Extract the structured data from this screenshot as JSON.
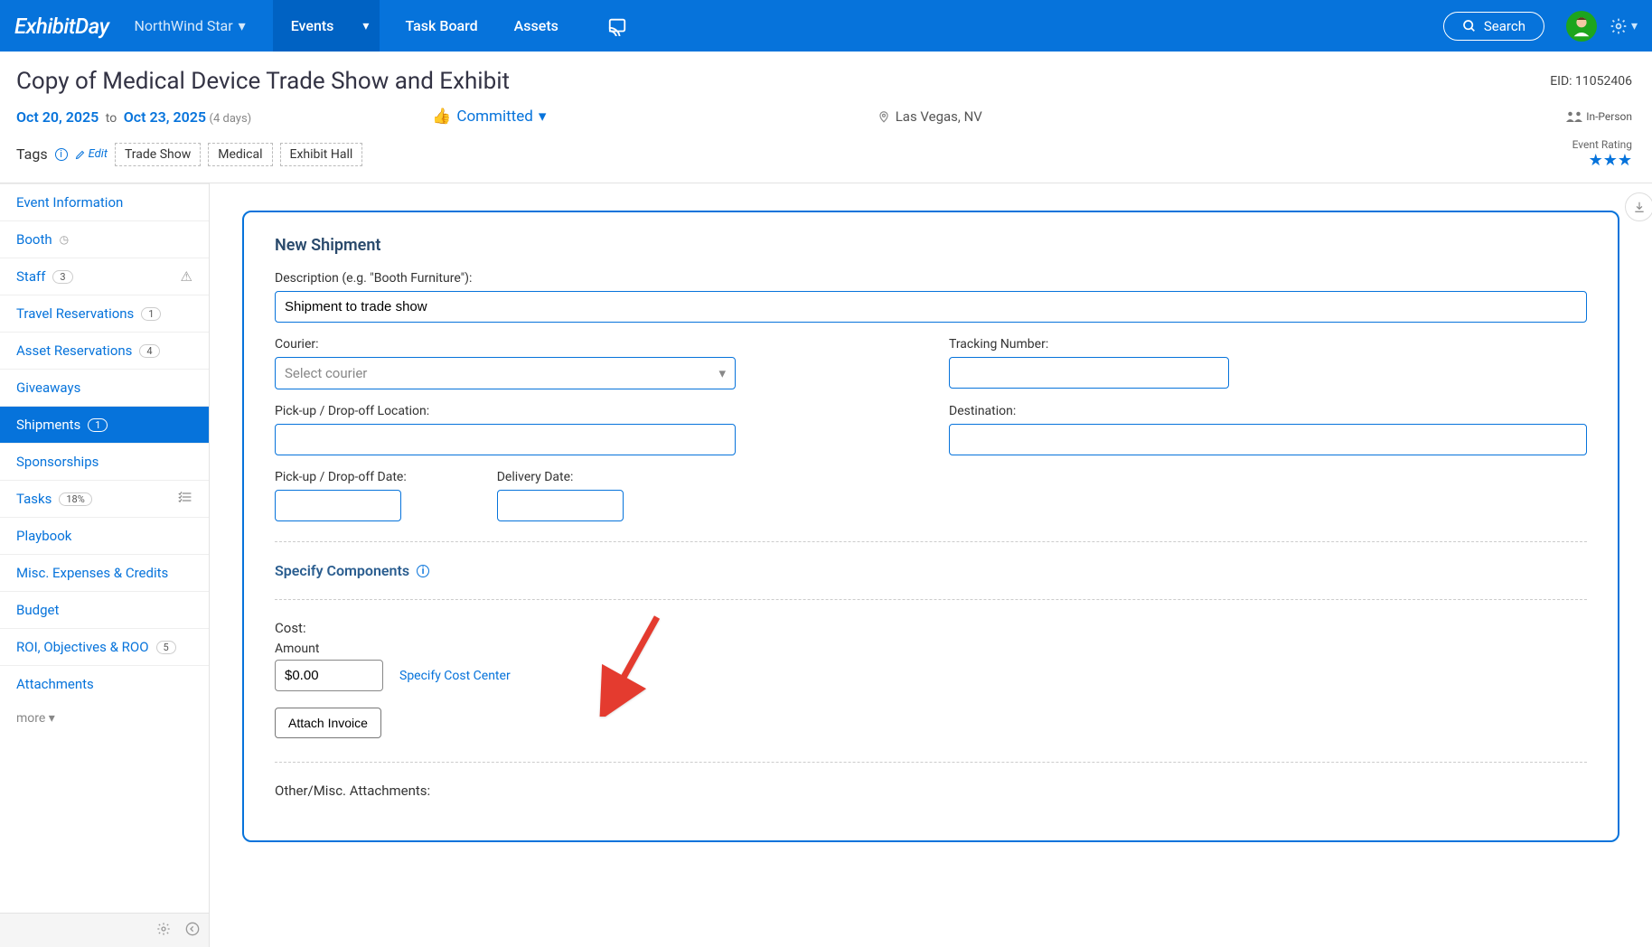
{
  "topnav": {
    "brand": "ExhibitDay",
    "org": "NorthWind Star",
    "tabs": {
      "events": "Events",
      "taskboard": "Task Board",
      "assets": "Assets"
    },
    "search": "Search"
  },
  "event": {
    "title": "Copy of Medical Device Trade Show and Exhibit",
    "eid_label": "EID:",
    "eid": "11052406",
    "start_date": "Oct 20, 2025",
    "to": "to",
    "end_date": "Oct 23, 2025",
    "days": "(4 days)",
    "status": "Committed",
    "location": "Las Vegas, NV",
    "format": "In-Person",
    "tags_label": "Tags",
    "edit": "Edit",
    "tags": [
      "Trade Show",
      "Medical",
      "Exhibit Hall"
    ],
    "rating_label": "Event Rating"
  },
  "sidebar": {
    "items": [
      {
        "label": "Event Information",
        "badge": null
      },
      {
        "label": "Booth",
        "badge": null,
        "clock": true
      },
      {
        "label": "Staff",
        "badge": "3",
        "warn": true
      },
      {
        "label": "Travel Reservations",
        "badge": "1"
      },
      {
        "label": "Asset Reservations",
        "badge": "4"
      },
      {
        "label": "Giveaways",
        "badge": null
      },
      {
        "label": "Shipments",
        "badge": "1",
        "active": true
      },
      {
        "label": "Sponsorships",
        "badge": null
      },
      {
        "label": "Tasks",
        "badge": "18%",
        "taskicon": true
      },
      {
        "label": "Playbook",
        "badge": null
      },
      {
        "label": "Misc. Expenses & Credits",
        "badge": null
      },
      {
        "label": "Budget",
        "badge": null
      },
      {
        "label": "ROI, Objectives & ROO",
        "badge": "5"
      },
      {
        "label": "Attachments",
        "badge": null
      }
    ],
    "more": "more"
  },
  "form": {
    "card_title": "New Shipment",
    "description_label": "Description (e.g. \"Booth Furniture\"):",
    "description_value": "Shipment to trade show",
    "courier_label": "Courier:",
    "courier_placeholder": "Select courier",
    "tracking_label": "Tracking Number:",
    "tracking_value": "",
    "pickup_loc_label": "Pick-up / Drop-off Location:",
    "pickup_loc_value": "",
    "destination_label": "Destination:",
    "destination_value": "",
    "pickup_date_label": "Pick-up / Drop-off Date:",
    "pickup_date_value": "",
    "delivery_date_label": "Delivery Date:",
    "delivery_date_value": "",
    "specify_components": "Specify Components",
    "cost_label": "Cost:",
    "amount_label": "Amount",
    "amount_value": "$0.00",
    "cost_center_link": "Specify Cost Center",
    "attach_invoice": "Attach Invoice",
    "other_attachments": "Other/Misc. Attachments:"
  }
}
